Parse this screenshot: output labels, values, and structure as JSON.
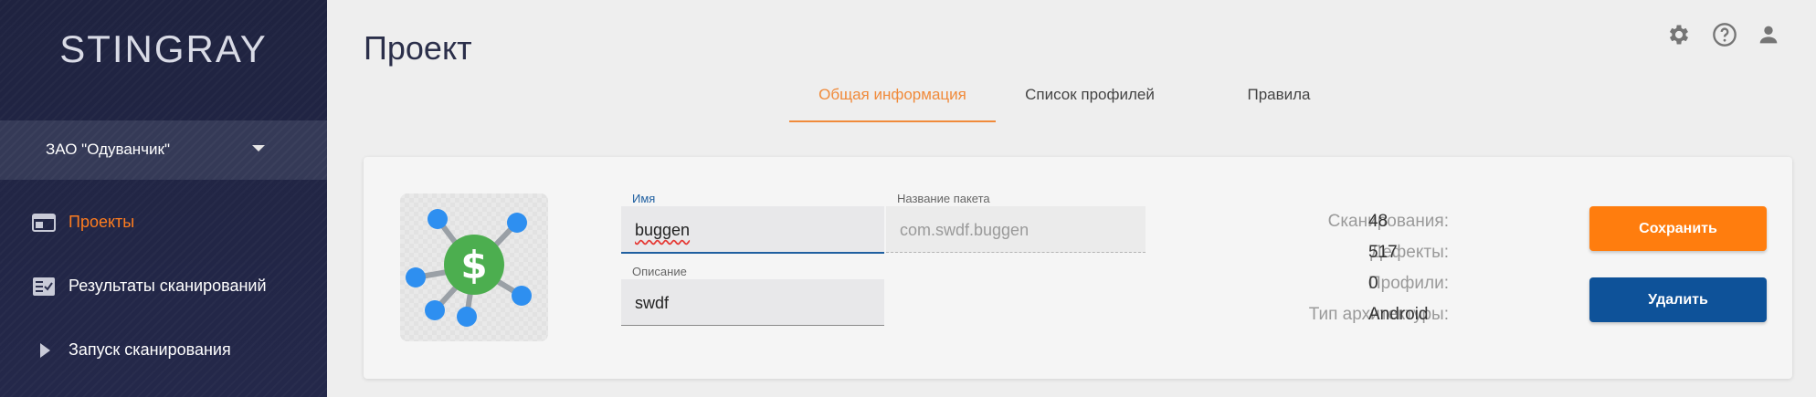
{
  "sidebar": {
    "logo": "STINGRAY",
    "org": "ЗАО \"Одуванчик\"",
    "items": [
      {
        "label": "Проекты",
        "icon": "projects-icon",
        "active": true
      },
      {
        "label": "Результаты сканирований",
        "icon": "scan-results-icon",
        "active": false
      },
      {
        "label": "Запуск сканирования",
        "icon": "play-icon",
        "active": false
      }
    ]
  },
  "header": {
    "title": "Проект",
    "icons": [
      "settings-icon",
      "help-icon",
      "user-icon"
    ]
  },
  "tabs": [
    {
      "label": "Общая информация",
      "active": true
    },
    {
      "label": "Список профилей",
      "active": false
    },
    {
      "label": "Правила",
      "active": false
    }
  ],
  "project": {
    "name_label": "Имя",
    "name_value": "buggen",
    "package_label": "Название пакета",
    "package_value": "com.swdf.buggen",
    "description_label": "Описание",
    "description_value": "swdf",
    "stats": [
      {
        "label": "Сканирования:",
        "value": "48"
      },
      {
        "label": "Дефекты:",
        "value": "517"
      },
      {
        "label": "Профили:",
        "value": "0"
      },
      {
        "label": "Тип архитектуры:",
        "value": "Android"
      }
    ],
    "save_label": "Сохранить",
    "delete_label": "Удалить"
  },
  "colors": {
    "accent_orange": "#ff7d0e",
    "primary_blue": "#0e5299",
    "sidebar_bg": "#1f2340"
  }
}
